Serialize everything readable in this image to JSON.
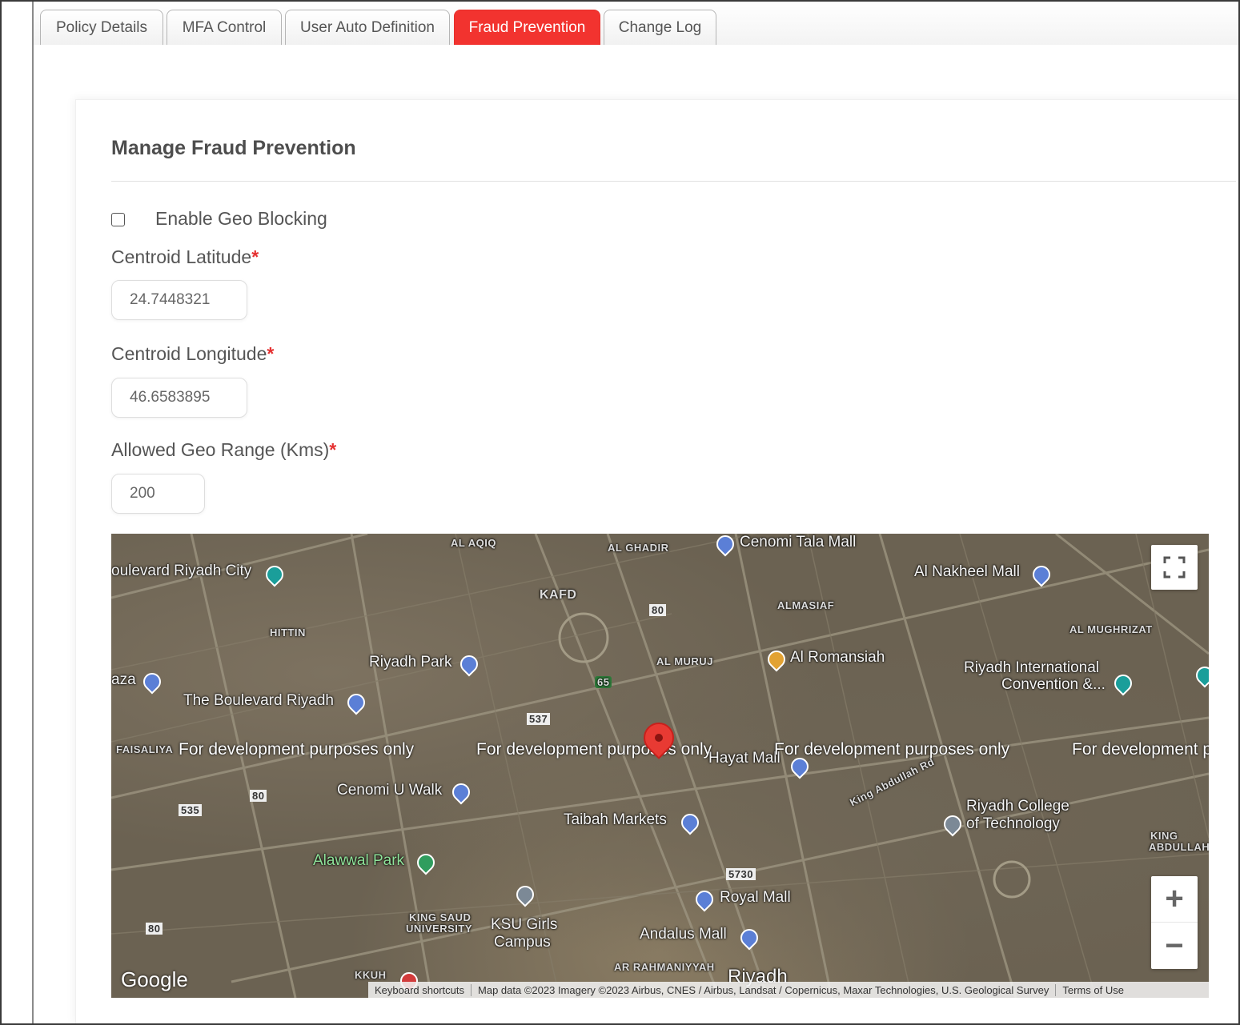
{
  "tabs": [
    {
      "label": "Policy Details",
      "active": false
    },
    {
      "label": "MFA Control",
      "active": false
    },
    {
      "label": "User Auto Definition",
      "active": false
    },
    {
      "label": "Fraud Prevention",
      "active": true
    },
    {
      "label": "Change Log",
      "active": false
    }
  ],
  "panel": {
    "title": "Manage Fraud Prevention",
    "geo_blocking_label": "Enable Geo Blocking",
    "geo_blocking_checked": false,
    "required_mark": "*",
    "latitude": {
      "label": "Centroid Latitude",
      "value": "24.7448321"
    },
    "longitude": {
      "label": "Centroid Longitude",
      "value": "46.6583895"
    },
    "range": {
      "label": "Allowed Geo Range (Kms)",
      "value": "200"
    }
  },
  "map": {
    "watermark": "For development purposes only",
    "labels": {
      "boulevard_city": "oulevard Riyadh City",
      "al_aqiq": "AL AQIQ",
      "al_ghadir": "AL GHADIR",
      "cenomi_tala": "Cenomi Tala Mall",
      "al_nakheel": "Al Nakheel Mall",
      "kafd": "KAFD",
      "hittin": "HITTIN",
      "almasiaf": "ALMASIAF",
      "al_mughrizat": "AL MUGHRIZAT",
      "riyadh_park": "Riyadh Park",
      "al_muruj": "AL MURUJ",
      "al_romansiah": "Al Romansiah",
      "riyadh_intl": "Riyadh International",
      "convention": "Convention &...",
      "aza": "aza",
      "boulevard_riyadh": "The Boulevard Riyadh",
      "faisaliya": "FAISALIYA",
      "hayat_mall": "Hayat Mall",
      "cenomi_u_walk": "Cenomi U Walk",
      "taibah": "Taibah Markets",
      "riyadh_college": "Riyadh College",
      "of_technology": "of Technology",
      "alawwal_park": "Alawwal Park",
      "royal_mall": "Royal Mall",
      "king_saud": "KING SAUD",
      "university": "UNIVERSITY",
      "ksu_girls": "KSU Girls",
      "campus": "Campus",
      "andalus_mall": "Andalus Mall",
      "ar_rahmaniyyah": "AR RAHMANIYYAH",
      "kkuh": "KKUH",
      "king_abdullah": "KING",
      "abdullah": "ABDULLAH",
      "riyadh": "Riyadh",
      "king_abdullah_rd": "King Abdullah Rd",
      "road_65": "65",
      "road_80": "80",
      "road_537": "537",
      "road_535": "535",
      "road_5730": "5730"
    },
    "google_logo": "Google",
    "attribution": {
      "shortcuts": "Keyboard shortcuts",
      "data": "Map data ©2023 Imagery ©2023 Airbus, CNES / Airbus, Landsat / Copernicus, Maxar Technologies, U.S. Geological Survey",
      "terms": "Terms of Use"
    },
    "zoom_in": "+",
    "zoom_out": "−"
  }
}
